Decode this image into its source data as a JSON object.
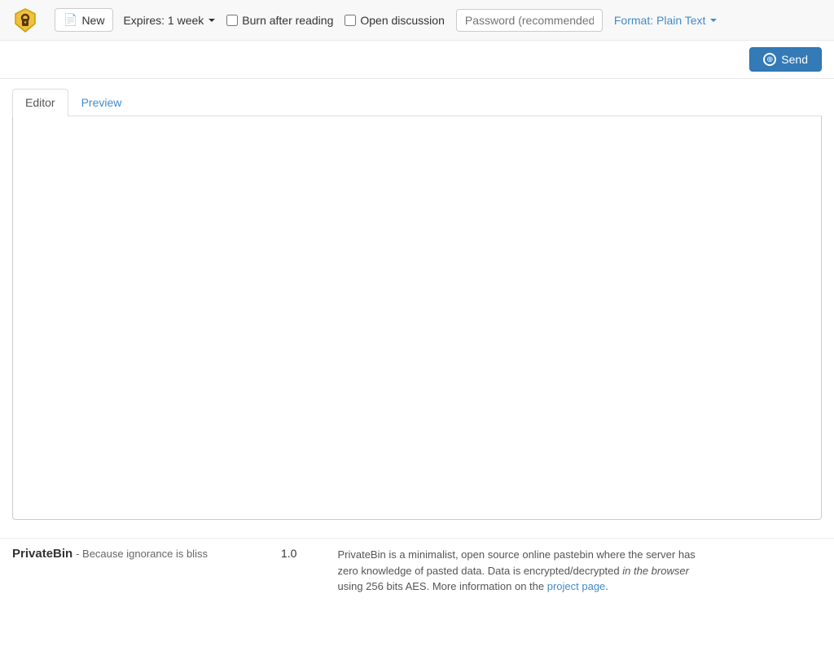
{
  "navbar": {
    "logo_alt": "PrivateBin logo",
    "new_button_label": "New",
    "new_icon": "📄",
    "expires_label": "Expires: 1 week",
    "burn_after_reading_label": "Burn after reading",
    "open_discussion_label": "Open discussion",
    "password_placeholder": "Password (recommended)",
    "format_label": "Format: Plain Text",
    "send_label": "Send"
  },
  "tabs": [
    {
      "id": "editor",
      "label": "Editor",
      "active": true
    },
    {
      "id": "preview",
      "label": "Preview",
      "active": false
    }
  ],
  "editor": {
    "placeholder": ""
  },
  "footer": {
    "brand_name": "PrivateBin",
    "tagline": "- Because ignorance is bliss",
    "version": "1.0",
    "description_text": "PrivateBin is a minimalist, open source online pastebin where the server has zero knowledge of pasted data. Data is encrypted/decrypted ",
    "description_em": "in the browser",
    "description_text2": " using 256 bits AES. More information on the ",
    "description_link": "project page",
    "description_end": "."
  }
}
